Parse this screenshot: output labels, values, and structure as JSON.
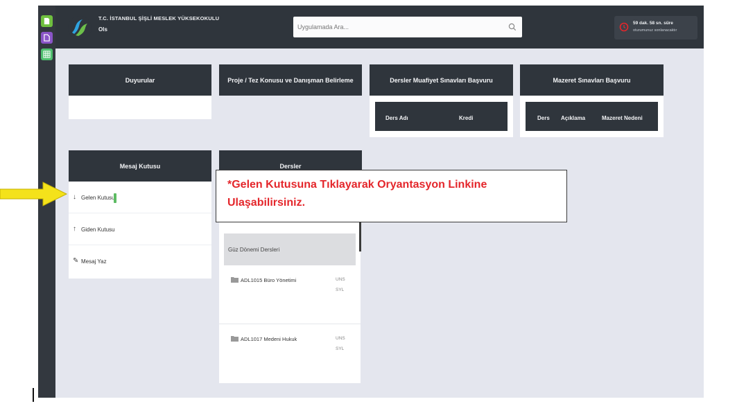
{
  "header": {
    "school_name": "T.C. İSTANBUL ŞİŞLİ MESLEK YÜKSEKOKULU",
    "user_role": "Ols",
    "search": {
      "placeholder": "Uygulamada Ara..."
    },
    "session": {
      "line1": "59 dak. 58 sn. süre",
      "line2": "oturumunuz sonlanacaktır"
    }
  },
  "cards": {
    "duyurular": {
      "title": "Duyurular"
    },
    "proje": {
      "title": "Proje / Tez Konusu ve Danışman Belirleme"
    },
    "muafiyet": {
      "title": "Dersler Muafiyet Sınavları Başvuru",
      "columns": [
        "Ders Adı",
        "Kredi"
      ]
    },
    "mazeret": {
      "title": "Mazeret Sınavları Başvuru",
      "columns": [
        "Ders",
        "Açıklama",
        "Mazeret Nedeni"
      ]
    },
    "mesaj": {
      "title": "Mesaj Kutusu",
      "items": [
        {
          "label": "Gelen Kutusu",
          "icon": "arrow-down-icon"
        },
        {
          "label": "Giden Kutusu",
          "icon": "arrow-up-icon"
        },
        {
          "label": "Mesaj Yaz",
          "icon": "pencil-icon"
        }
      ]
    },
    "dersler": {
      "title": "Dersler",
      "group": "Güz Dönemi Dersleri",
      "courses": [
        {
          "name": "ADL1015 Büro Yönetimi",
          "c1": "UNS",
          "c2": "SYL"
        },
        {
          "name": "ADL1017 Medeni Hukuk",
          "c1": "UNS",
          "c2": "SYL"
        }
      ]
    }
  },
  "callout": {
    "line1": "*Gelen Kutusuna Tıklayarak Oryantasyon Linkine",
    "line2": "Ulaşabilirsiniz."
  },
  "colors": {
    "accent_red": "#e4262b",
    "arrow_yellow": "#f4e21b",
    "dark_header": "#2f353c",
    "badge_green": "#5dbb63"
  }
}
